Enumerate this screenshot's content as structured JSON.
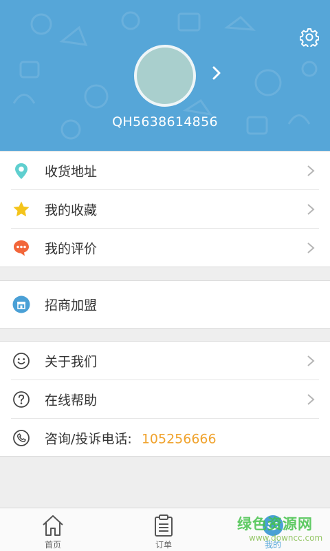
{
  "profile": {
    "user_id": "QH5638614856"
  },
  "menu_group_1": [
    {
      "label": "收货地址",
      "icon": "location-pin-icon",
      "color": "#5fcfcf"
    },
    {
      "label": "我的收藏",
      "icon": "star-icon",
      "color": "#f4c41b"
    },
    {
      "label": "我的评价",
      "icon": "chat-bubble-icon",
      "color": "#f2663a"
    }
  ],
  "menu_group_2": [
    {
      "label": "招商加盟",
      "icon": "shop-icon",
      "color": "#4aa0d6"
    }
  ],
  "menu_group_3": [
    {
      "label": "关于我们",
      "icon": "smiley-icon"
    },
    {
      "label": "在线帮助",
      "icon": "help-circle-icon"
    },
    {
      "label": "咨询/投诉电话:",
      "value": "105256666",
      "icon": "phone-icon"
    }
  ],
  "tabbar": [
    {
      "label": "首页",
      "icon": "home-icon"
    },
    {
      "label": "订单",
      "icon": "clipboard-icon"
    },
    {
      "label": "我的",
      "icon": "smiley-face-icon",
      "active": true
    }
  ],
  "watermark": {
    "text": "绿色资源网",
    "url": "www.downcc.com"
  },
  "colors": {
    "header_bg": "#56a6d8",
    "accent": "#4aa0d6",
    "phone": "#f0a32e"
  }
}
